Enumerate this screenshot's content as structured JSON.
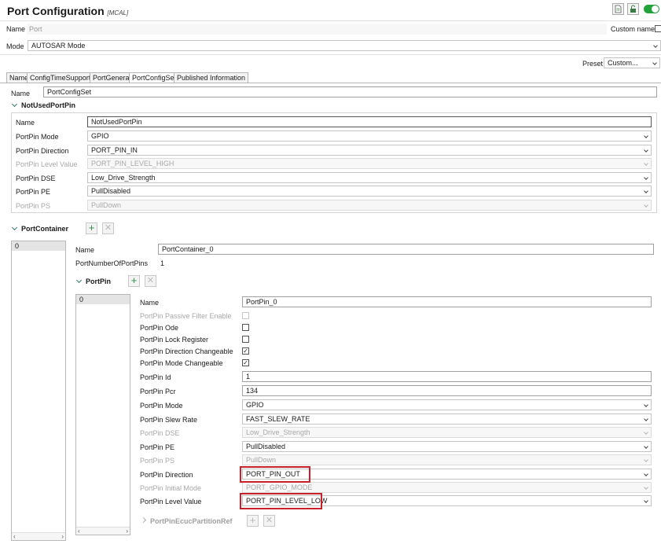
{
  "title": "Port Configuration",
  "title_tag": "[MCAL]",
  "name_label": "Name",
  "name_value": "Port",
  "custom_name_label": "Custom name",
  "mode_label": "Mode",
  "mode_value": "AUTOSAR Mode",
  "preset_label": "Preset",
  "preset_value": "Custom...",
  "tabs": [
    "Name",
    "ConfigTimeSupport",
    "PortGeneral",
    "PortConfigSet",
    "Published Information"
  ],
  "cfg_name_label": "Name",
  "cfg_name_value": "PortConfigSet",
  "notused": {
    "title": "NotUsedPortPin",
    "name_label": "Name",
    "name_value": "NotUsedPortPin",
    "mode_label": "PortPin Mode",
    "mode_value": "GPIO",
    "dir_label": "PortPin Direction",
    "dir_value": "PORT_PIN_IN",
    "level_label": "PortPin Level Value",
    "level_value": "PORT_PIN_LEVEL_HIGH",
    "dse_label": "PortPin DSE",
    "dse_value": "Low_Drive_Strength",
    "pe_label": "PortPin PE",
    "pe_value": "PullDisabled",
    "ps_label": "PortPin PS",
    "ps_value": "PullDown"
  },
  "container": {
    "title": "PortContainer",
    "item": "0",
    "name_label": "Name",
    "name_value": "PortContainer_0",
    "count_label": "PortNumberOfPortPins",
    "count_value": "1"
  },
  "portpin": {
    "title": "PortPin",
    "item": "0",
    "name_label": "Name",
    "name_value": "PortPin_0",
    "pfe_label": "PortPin Passive Filter Enable",
    "ode_label": "PortPin Ode",
    "lock_label": "PortPin Lock Register",
    "dirch_label": "PortPin Direction Changeable",
    "modech_label": "PortPin Mode Changeable",
    "id_label": "PortPin Id",
    "id_value": "1",
    "pcr_label": "PortPin Pcr",
    "pcr_value": "134",
    "mode_label": "PortPin Mode",
    "mode_value": "GPIO",
    "slew_label": "PortPin Slew Rate",
    "slew_value": "FAST_SLEW_RATE",
    "dse_label": "PortPin DSE",
    "dse_value": "Low_Drive_Strength",
    "pe_label": "PortPin PE",
    "pe_value": "PullDisabled",
    "ps_label": "PortPin PS",
    "ps_value": "PullDown",
    "dir_label": "PortPin Direction",
    "dir_value": "PORT_PIN_OUT",
    "initmode_label": "PortPin Initial Mode",
    "initmode_value": "PORT_GPIO_MODE",
    "level_label": "PortPin Level Value",
    "level_value": "PORT_PIN_LEVEL_LOW",
    "ecuc_label": "PortPinEcucPartitionRef"
  },
  "colors": {
    "highlight": "#c9202a",
    "toggle": "#22a33a"
  },
  "icons": [
    "document-icon",
    "lock-icon",
    "toggle-icon",
    "add-icon",
    "remove-icon"
  ]
}
